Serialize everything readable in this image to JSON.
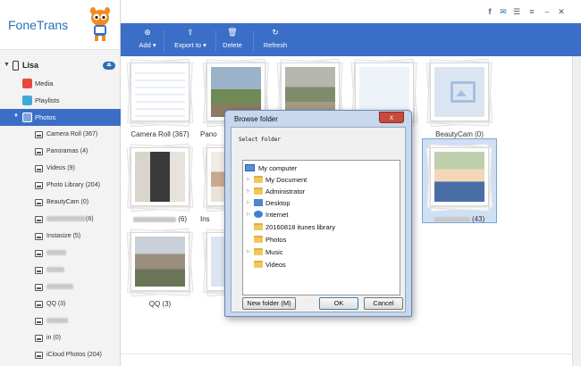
{
  "app": {
    "title": "FoneTrans"
  },
  "device": {
    "name": "Lisa"
  },
  "nav": [
    {
      "label": "Media",
      "icon": "music-note-icon",
      "color": "#e64a3c"
    },
    {
      "label": "Playlists",
      "icon": "playlist-icon",
      "color": "#3fa9dc"
    },
    {
      "label": "Photos",
      "icon": "photos-icon",
      "color": "#ffffff"
    }
  ],
  "photo_albums": [
    "Camera Roll (367)",
    "Panoramas (4)",
    "Videos (9)",
    "Photo Library (204)",
    "BeautyCam (0)",
    "(6)",
    "Instasize (5)",
    "",
    "",
    "",
    "QQ (3)",
    "",
    "in (0)",
    "iCloud Photos (204)"
  ],
  "toolbar": {
    "add": "Add",
    "export": "Export to",
    "delete": "Delete",
    "refresh": "Refresh"
  },
  "grid": {
    "row1": [
      "Camera Roll (367)",
      "Pano",
      "",
      "",
      "BeautyCam (0)"
    ],
    "row2": [
      "(6)",
      "Ins",
      "(43)"
    ],
    "row3": [
      "QQ (3)"
    ]
  },
  "dialog": {
    "title": "Browse folder",
    "close": "x",
    "prompt": "Select Folder",
    "tree": [
      {
        "label": "My computer",
        "icon": "computer-icon"
      },
      {
        "label": "My Document",
        "icon": "folder-icon"
      },
      {
        "label": "Administrator",
        "icon": "user-folder-icon"
      },
      {
        "label": "Desktop",
        "icon": "desktop-icon"
      },
      {
        "label": "Internet",
        "icon": "globe-icon"
      },
      {
        "label": "20160818 itunes library",
        "icon": "folder-icon"
      },
      {
        "label": "Photos",
        "icon": "folder-icon"
      },
      {
        "label": "Music",
        "icon": "folder-icon"
      },
      {
        "label": "Videos",
        "icon": "folder-icon"
      }
    ],
    "new_folder": "New folder (M)",
    "ok": "OK",
    "cancel": "Cancel"
  },
  "colors": {
    "accent": "#3b6ec6",
    "dialog_frame": "#c6d7ee",
    "close": "#c74a3a"
  }
}
